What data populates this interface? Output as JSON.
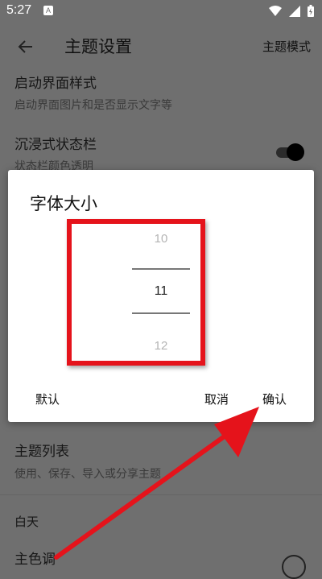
{
  "status_bar": {
    "time": "5:27",
    "app_badge": "A"
  },
  "toolbar": {
    "title": "主题设置",
    "mode_label": "主题模式",
    "back_icon": "arrow-left-icon"
  },
  "settings": {
    "launch_style": {
      "title": "启动界面样式",
      "subtitle": "启动界面图片和是否显示文字等"
    },
    "immersive": {
      "title": "沉浸式状态栏",
      "subtitle": "状态栏颜色透明",
      "toggle_on": true
    },
    "theme_list": {
      "title": "主题列表",
      "subtitle": "使用、保存、导入或分享主题"
    },
    "day_section": "白天",
    "primary_color": {
      "title": "主色调"
    }
  },
  "dialog": {
    "title": "字体大小",
    "picker": {
      "prev": "10",
      "selected": "11",
      "next": "12"
    },
    "buttons": {
      "default": "默认",
      "cancel": "取消",
      "confirm": "确认"
    }
  },
  "colors": {
    "annotation_red": "#e5131b",
    "scrim": "#6f6f6f"
  }
}
